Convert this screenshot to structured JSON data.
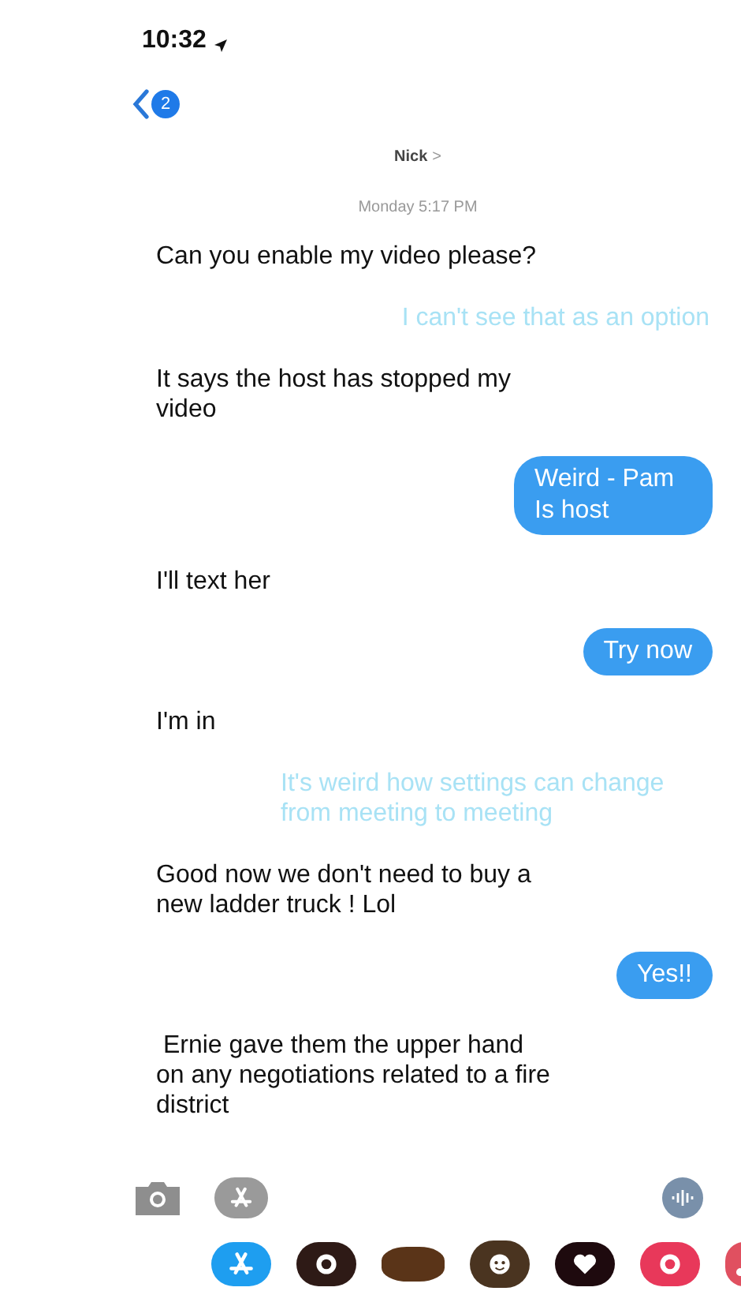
{
  "status_bar": {
    "time": "10:32"
  },
  "nav": {
    "back_badge": "2",
    "contact": "Nick",
    "contact_chevron": ">"
  },
  "timestamp": "Monday 5:17 PM",
  "messages": [
    {
      "kind": "received",
      "text": "Can you enable my video please?"
    },
    {
      "kind": "sent_faded",
      "text": "I can't see that as an option"
    },
    {
      "kind": "received",
      "text": "It says the host has stopped my video"
    },
    {
      "kind": "sent",
      "text": "Weird - Pam Is host"
    },
    {
      "kind": "received",
      "text": "I'll text her"
    },
    {
      "kind": "sent",
      "text": "Try now"
    },
    {
      "kind": "received",
      "text": "I'm in"
    },
    {
      "kind": "sent_faded",
      "text": "It's weird how settings can change from meeting to meeting"
    },
    {
      "kind": "received",
      "text": "Good now we don't need to buy a new ladder truck ! Lol"
    },
    {
      "kind": "sent",
      "text": "Yes!!"
    },
    {
      "kind": "received",
      "text": " Ernie gave them the upper hand on any negotiations related to a fire district"
    }
  ],
  "app_strip": [
    {
      "kind": "appstore",
      "color": "#1e9ef0"
    },
    {
      "kind": "sticker",
      "color": "#2e1a16"
    },
    {
      "kind": "blob",
      "color": "#5a3418"
    },
    {
      "kind": "face",
      "color": "#4a3420"
    },
    {
      "kind": "heart",
      "color": "#1e0a0e"
    },
    {
      "kind": "sticker",
      "color": "#e8385a"
    },
    {
      "kind": "music",
      "color": "#e05060"
    }
  ]
}
